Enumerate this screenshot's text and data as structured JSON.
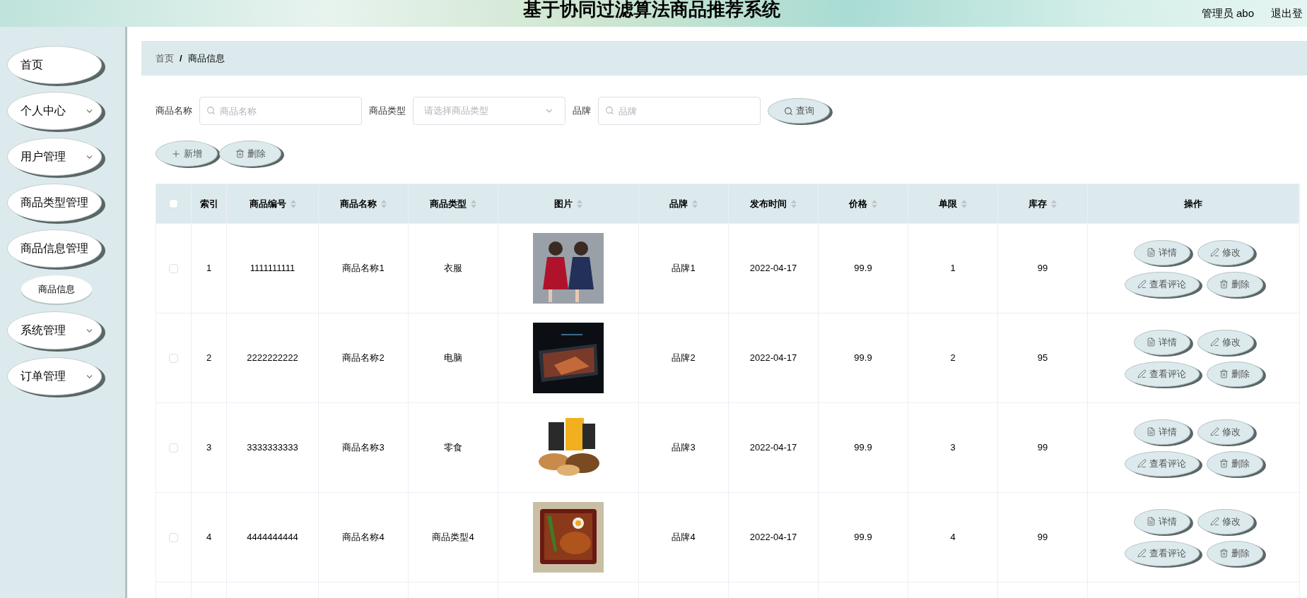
{
  "header": {
    "title": "基于协同过滤算法商品推荐系统",
    "user": "管理员 abo",
    "logout": "退出登"
  },
  "sidebar": {
    "items": [
      {
        "label": "首页",
        "kind": "plain"
      },
      {
        "label": "个人中心",
        "kind": "dropdown"
      },
      {
        "label": "用户管理",
        "kind": "dropdown"
      },
      {
        "label": "商品类型管理",
        "kind": "plain"
      },
      {
        "label": "商品信息管理",
        "kind": "plain",
        "children": [
          {
            "label": "商品信息"
          }
        ]
      },
      {
        "label": "系统管理",
        "kind": "dropdown"
      },
      {
        "label": "订单管理",
        "kind": "dropdown"
      }
    ]
  },
  "breadcrumb": [
    "首页",
    "商品信息"
  ],
  "breadcrumb_separator": "/",
  "filters": [
    {
      "label": "商品名称",
      "kind": "text",
      "placeholder": "商品名称"
    },
    {
      "label": "商品类型",
      "kind": "select",
      "placeholder": "请选择商品类型"
    },
    {
      "label": "品牌",
      "kind": "text",
      "placeholder": "品牌"
    }
  ],
  "search_button": "查询",
  "toolbar": [
    {
      "label": "新增",
      "kind": "add"
    },
    {
      "label": "删除",
      "kind": "delete"
    }
  ],
  "table": {
    "header_checked": false,
    "columns": [
      {
        "label": "索引",
        "sortable": false
      },
      {
        "label": "商品编号",
        "sortable": true
      },
      {
        "label": "商品名称",
        "sortable": true
      },
      {
        "label": "商品类型",
        "sortable": true
      },
      {
        "label": "图片",
        "sortable": true
      },
      {
        "label": "品牌",
        "sortable": true
      },
      {
        "label": "发布时间",
        "sortable": true
      },
      {
        "label": "价格",
        "sortable": true
      },
      {
        "label": "单限",
        "sortable": true
      },
      {
        "label": "库存",
        "sortable": true
      },
      {
        "label": "操作",
        "sortable": false
      }
    ],
    "rows": [
      {
        "checked": false,
        "cells": [
          "1",
          "1111111111",
          "商品名称1",
          "衣服"
        ],
        "cells2": [
          "品牌1",
          "2022-04-17",
          "99.9",
          "1",
          "99"
        ],
        "actions": [
          {
            "label": "详情",
            "kind": "detail"
          },
          {
            "label": "修改",
            "kind": "edit"
          },
          {
            "label": "查看评论",
            "kind": "comment"
          },
          {
            "label": "删除",
            "kind": "delete"
          }
        ]
      },
      {
        "checked": false,
        "cells": [
          "2",
          "2222222222",
          "商品名称2",
          "电脑"
        ],
        "cells2": [
          "品牌2",
          "2022-04-17",
          "99.9",
          "2",
          "95"
        ],
        "actions": [
          {
            "label": "详情",
            "kind": "detail"
          },
          {
            "label": "修改",
            "kind": "edit"
          },
          {
            "label": "查看评论",
            "kind": "comment"
          },
          {
            "label": "删除",
            "kind": "delete"
          }
        ]
      },
      {
        "checked": false,
        "cells": [
          "3",
          "3333333333",
          "商品名称3",
          "零食"
        ],
        "cells2": [
          "品牌3",
          "2022-04-17",
          "99.9",
          "3",
          "99"
        ],
        "actions": [
          {
            "label": "详情",
            "kind": "detail"
          },
          {
            "label": "修改",
            "kind": "edit"
          },
          {
            "label": "查看评论",
            "kind": "comment"
          },
          {
            "label": "删除",
            "kind": "delete"
          }
        ]
      },
      {
        "checked": false,
        "cells": [
          "4",
          "4444444444",
          "商品名称4",
          "商品类型4"
        ],
        "cells2": [
          "品牌4",
          "2022-04-17",
          "99.9",
          "4",
          "99"
        ],
        "actions": [
          {
            "label": "详情",
            "kind": "detail"
          },
          {
            "label": "修改",
            "kind": "edit"
          },
          {
            "label": "查看评论",
            "kind": "comment"
          },
          {
            "label": "删除",
            "kind": "delete"
          }
        ]
      }
    ]
  }
}
